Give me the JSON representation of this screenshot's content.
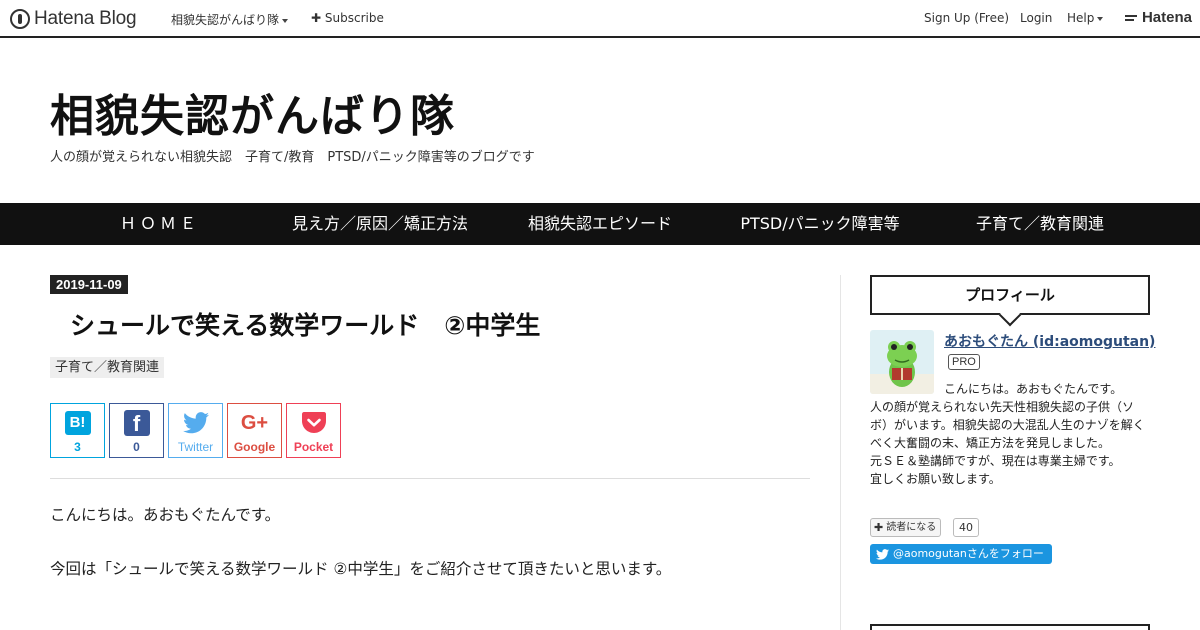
{
  "topbar": {
    "logo_text": "Hatena Blog",
    "blog_menu": "相貌失認がんばり隊",
    "subscribe": "Subscribe",
    "signup": "Sign Up (Free)",
    "login": "Login",
    "help": "Help",
    "hatena": "Hatena"
  },
  "header": {
    "title": "相貌失認がんばり隊",
    "description": "人の顔が覚えられない相貌失認　子育て/教育　PTSD/パニック障害等のブログです"
  },
  "nav": {
    "items": [
      {
        "label": "ＨＯＭＥ"
      },
      {
        "label": "見え方／原因／矯正方法"
      },
      {
        "label": "相貌失認エピソード"
      },
      {
        "label": "PTSD/パニック障害等"
      },
      {
        "label": "子育て／教育関連"
      }
    ]
  },
  "entry": {
    "date": "2019-11-09",
    "title": "シュールで笑える数学ワールド　②中学生",
    "category": "子育て／教育関連",
    "share": {
      "hatena": {
        "icon": "B!",
        "count": "3"
      },
      "facebook": {
        "icon": "f",
        "count": "0"
      },
      "twitter": {
        "label": "Twitter"
      },
      "google": {
        "icon": "G+",
        "label": "Google"
      },
      "pocket": {
        "label": "Pocket"
      }
    },
    "paragraphs": [
      "こんにちは。あおもぐたんです。",
      "今回は「シュールで笑える数学ワールド ②中学生」をご紹介させて頂きたいと思います。"
    ]
  },
  "sidebar": {
    "profile_heading": "プロフィール",
    "name": "あおもぐたん (id:aomogutan)",
    "badge": "PRO",
    "text_lines": [
      "こんにちは。あおもぐたんです。",
      "人の顔が覚えられない先天性相貌失認の子供（ソボ）がいます。相貌失認の大混乱人生のナゾを解くべく大奮闘の末、矯正方法を発見しました。",
      "元ＳＥ＆塾講師ですが、現在は専業主婦です。",
      "宜しくお願い致します。"
    ],
    "reader_button": "読者になる",
    "reader_count": "40",
    "twitter_follow": "@aomogutanさんをフォロー"
  },
  "colors": {
    "nav_bg": "#111111",
    "hatena_blue": "#00a4de",
    "facebook": "#3b5998",
    "twitter": "#55acee",
    "google": "#dc4e41",
    "pocket": "#ef4056"
  }
}
